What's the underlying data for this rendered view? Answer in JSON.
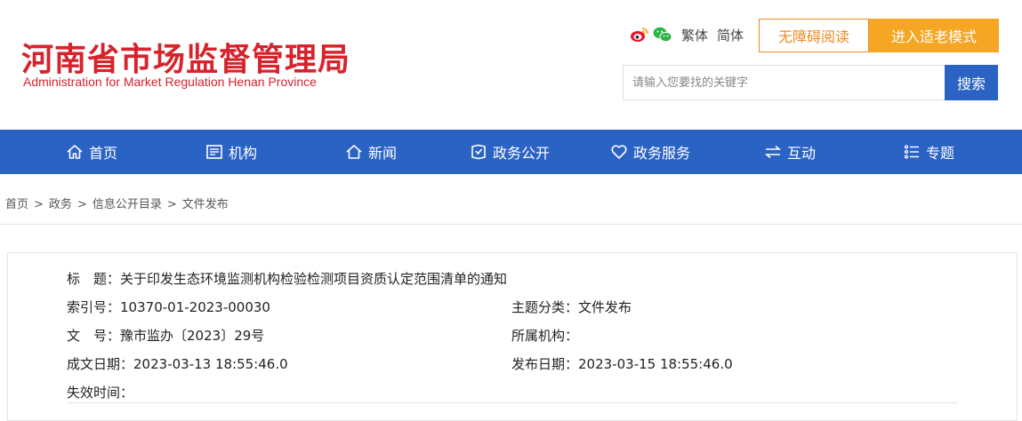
{
  "header": {
    "logo_cn": "河南省市场监督管理局",
    "logo_en": "Administration for Market Regulation Henan Province",
    "icons": [
      "weibo-icon",
      "wechat-icon"
    ],
    "lang_traditional": "繁体",
    "lang_simplified": "简体",
    "accessible_label": "无障碍阅读",
    "elder_label": "进入适老模式",
    "search_placeholder": "请输入您要找的关键字",
    "search_button": "搜索"
  },
  "nav": {
    "items": [
      {
        "label": "首页",
        "icon": "home-icon"
      },
      {
        "label": "机构",
        "icon": "org-icon"
      },
      {
        "label": "新闻",
        "icon": "news-icon"
      },
      {
        "label": "政务公开",
        "icon": "open-gov-icon"
      },
      {
        "label": "政务服务",
        "icon": "heart-icon"
      },
      {
        "label": "互动",
        "icon": "exchange-icon"
      },
      {
        "label": "专题",
        "icon": "topic-icon"
      }
    ]
  },
  "breadcrumb": {
    "items": [
      "首页",
      "政务",
      "信息公开目录",
      "文件发布"
    ],
    "separator": ">"
  },
  "doc": {
    "title_label": "标　题：",
    "title_value": "关于印发生态环境监测机构检验检测项目资质认定范围清单的通知",
    "index_label": "索引号：",
    "index_value": "10370-01-2023-00030",
    "subject_label": "主题分类：",
    "subject_value": "文件发布",
    "docno_label": "文　号：",
    "docno_value": "豫市监办〔2023〕29号",
    "org_label": "所属机构：",
    "org_value": "",
    "created_label": "成文日期：",
    "created_value": "2023-03-13 18:55:46.0",
    "published_label": "发布日期：",
    "published_value": "2023-03-15 18:55:46.0",
    "expiry_label": "失效时间：",
    "expiry_value": ""
  },
  "colors": {
    "brand_red": "#d6232c",
    "nav_blue": "#2b63c4",
    "orange": "#f08a24",
    "orange_fill": "#f5a623"
  }
}
